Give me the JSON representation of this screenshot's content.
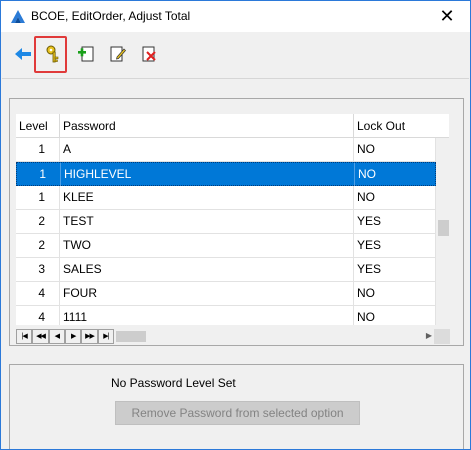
{
  "window": {
    "title": "BCOE, EditOrder, Adjust Total",
    "close_glyph": "✕"
  },
  "toolbar": {
    "buttons": [
      {
        "name": "back-arrow-icon"
      },
      {
        "name": "key-icon"
      },
      {
        "name": "add-icon"
      },
      {
        "name": "edit-icon"
      },
      {
        "name": "delete-icon"
      }
    ],
    "highlight_color": "#e03a3a"
  },
  "grid": {
    "columns": [
      "Level",
      "Password",
      "Lock Out"
    ],
    "rows": [
      {
        "level": "1",
        "password": "A",
        "lockout": "NO"
      },
      {
        "level": "1",
        "password": "HIGHLEVEL",
        "lockout": "NO"
      },
      {
        "level": "1",
        "password": "KLEE",
        "lockout": "NO"
      },
      {
        "level": "2",
        "password": "TEST",
        "lockout": "YES"
      },
      {
        "level": "2",
        "password": "TWO",
        "lockout": "YES"
      },
      {
        "level": "3",
        "password": "SALES",
        "lockout": "YES"
      },
      {
        "level": "4",
        "password": "FOUR",
        "lockout": "NO"
      },
      {
        "level": "4",
        "password": "1111",
        "lockout": "NO"
      }
    ],
    "selected_index": 1,
    "selection_color": "#0078d7",
    "nav_buttons": [
      "|◀",
      "◀◀",
      "◀",
      "▶",
      "▶▶",
      "▶|"
    ]
  },
  "status": {
    "text": "No Password Level Set"
  },
  "remove_button": {
    "label": "Remove Password from selected option"
  }
}
